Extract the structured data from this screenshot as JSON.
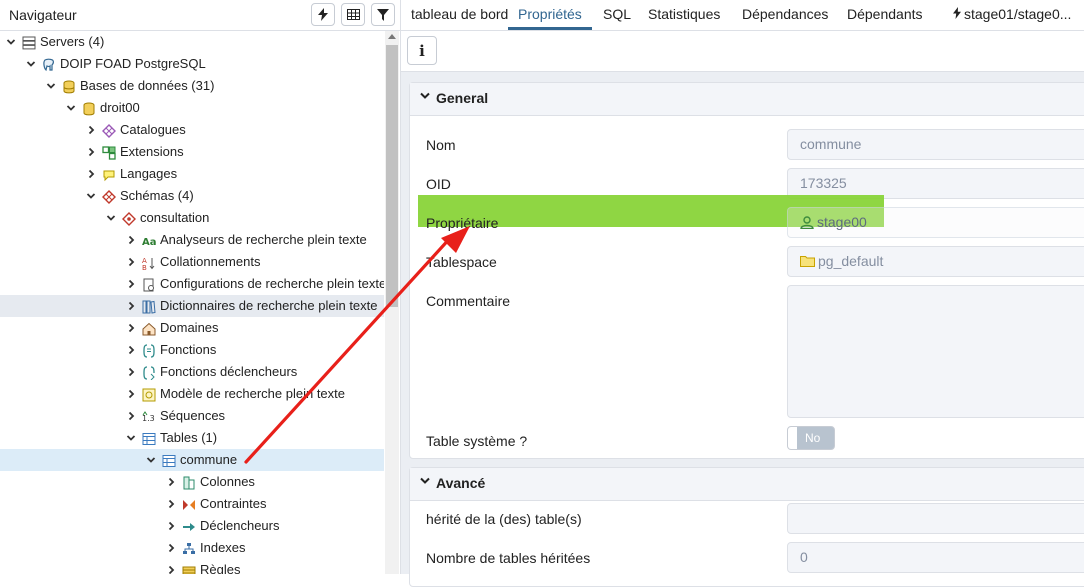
{
  "navigator": {
    "title": "Navigateur",
    "tree": [
      {
        "label": "Servers (4)",
        "icon": "servers-icon",
        "toggle": "down"
      },
      {
        "label": "DOIP FOAD PostgreSQL",
        "icon": "postgresql-elephant-icon",
        "toggle": "down"
      },
      {
        "label": "Bases de données (31)",
        "icon": "databases-icon",
        "toggle": "down"
      },
      {
        "label": "droit00",
        "icon": "database-icon",
        "toggle": "down"
      },
      {
        "label": "Catalogues",
        "icon": "catalogs-icon",
        "toggle": "right"
      },
      {
        "label": "Extensions",
        "icon": "extensions-icon",
        "toggle": "right"
      },
      {
        "label": "Langages",
        "icon": "languages-icon",
        "toggle": "right"
      },
      {
        "label": "Schémas (4)",
        "icon": "schemas-icon",
        "toggle": "down"
      },
      {
        "label": "consultation",
        "icon": "schema-icon",
        "toggle": "down"
      },
      {
        "label": "Analyseurs de recherche plein texte",
        "icon": "fts-parser-icon",
        "toggle": "right"
      },
      {
        "label": "Collationnements",
        "icon": "collation-icon",
        "toggle": "right"
      },
      {
        "label": "Configurations de recherche plein texte",
        "icon": "fts-config-icon",
        "toggle": "right"
      },
      {
        "label": "Dictionnaires de recherche plein texte",
        "icon": "fts-dictionary-icon",
        "toggle": "right"
      },
      {
        "label": "Domaines",
        "icon": "domains-icon",
        "toggle": "right"
      },
      {
        "label": "Fonctions",
        "icon": "functions-icon",
        "toggle": "right"
      },
      {
        "label": "Fonctions déclencheurs",
        "icon": "trigger-functions-icon",
        "toggle": "right"
      },
      {
        "label": "Modèle de recherche plein texte",
        "icon": "fts-template-icon",
        "toggle": "right"
      },
      {
        "label": "Séquences",
        "icon": "sequences-icon",
        "toggle": "right"
      },
      {
        "label": "Tables (1)",
        "icon": "tables-icon",
        "toggle": "down"
      },
      {
        "label": "commune",
        "icon": "table-icon",
        "toggle": "down"
      },
      {
        "label": "Colonnes",
        "icon": "columns-icon",
        "toggle": "right"
      },
      {
        "label": "Contraintes",
        "icon": "constraints-icon",
        "toggle": "right"
      },
      {
        "label": "Déclencheurs",
        "icon": "triggers-icon",
        "toggle": "right"
      },
      {
        "label": "Indexes",
        "icon": "indexes-icon",
        "toggle": "right"
      },
      {
        "label": "Règles",
        "icon": "rules-icon",
        "toggle": "right"
      }
    ]
  },
  "tabs": [
    {
      "label": "tableau de bord"
    },
    {
      "label": "Propriétés"
    },
    {
      "label": "SQL"
    },
    {
      "label": "Statistiques"
    },
    {
      "label": "Dépendances"
    },
    {
      "label": "Dépendants"
    },
    {
      "label": "stage01/stage0..."
    }
  ],
  "active_tab": "Propriétés",
  "toolbar": {
    "info_label": "i"
  },
  "general": {
    "title": "General",
    "name_label": "Nom",
    "name_value": "commune",
    "oid_label": "OID",
    "oid_value": "173325",
    "owner_label": "Propriétaire",
    "owner_value": "stage00",
    "tablespace_label": "Tablespace",
    "tablespace_value": "pg_default",
    "comment_label": "Commentaire",
    "comment_value": "",
    "system_label": "Table système ?",
    "system_value": "No"
  },
  "advanced": {
    "title": "Avancé",
    "inherited_label": "hérité de la (des) table(s)",
    "inherited_value": "",
    "inherited_count_label": "Nombre de tables héritées",
    "inherited_count_value": "0"
  },
  "colors": {
    "accent": "#326690",
    "highlight": "#86d233",
    "arrow": "#e8201a"
  }
}
